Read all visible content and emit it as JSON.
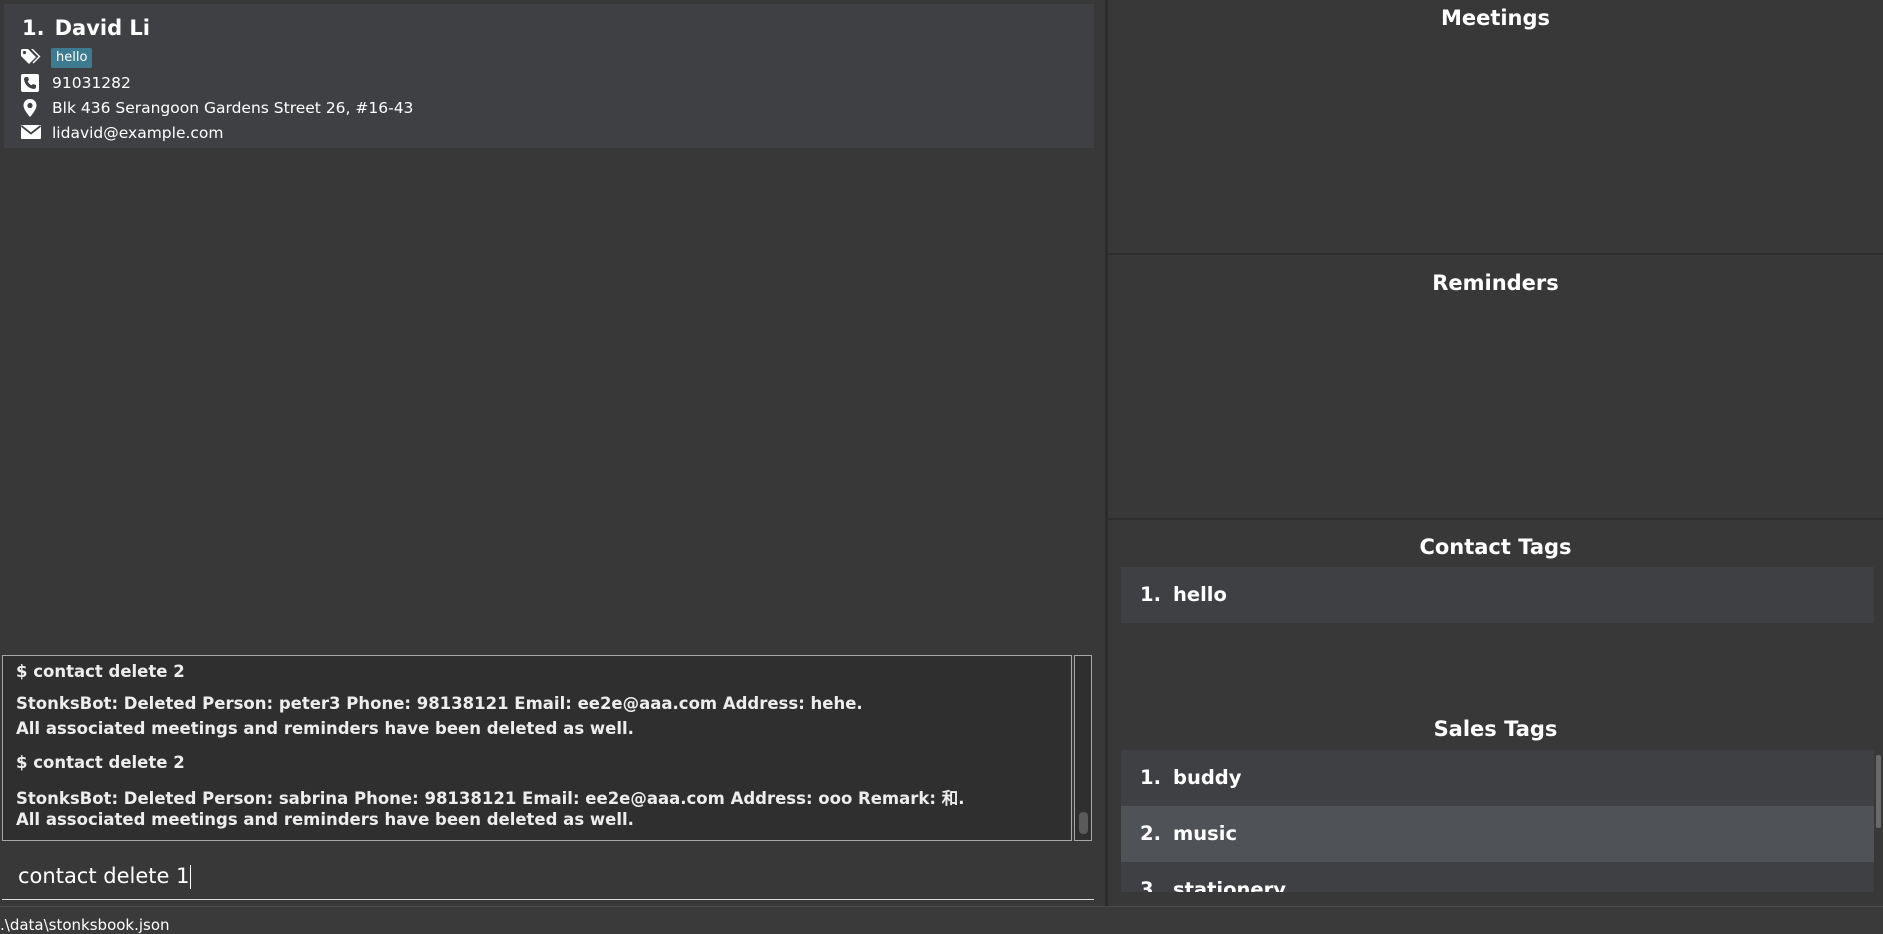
{
  "person_list": [
    {
      "index": "1.",
      "name": "David Li",
      "tags": [
        "hello"
      ],
      "phone": "91031282",
      "address": "Blk 436 Serangoon Gardens Street 26, #16-43",
      "email": "lidavid@example.com"
    }
  ],
  "result_display": {
    "lines": [
      "$ contact delete 2",
      "StonksBot: Deleted Person: peter3 Phone: 98138121 Email: ee2e@aaa.com Address: hehe.",
      "All associated meetings and reminders have been deleted as well.",
      "$ contact delete 2",
      "StonksBot: Deleted Person: sabrina Phone: 98138121 Email: ee2e@aaa.com Address: ooo Remark: 和.",
      "All associated meetings and reminders have been deleted as well."
    ]
  },
  "command_box": {
    "value": "contact delete 1"
  },
  "status_bar": {
    "file_path": ".\\data\\stonksbook.json"
  },
  "panels": {
    "meetings": {
      "title": "Meetings"
    },
    "reminders": {
      "title": "Reminders"
    },
    "contact_tags": {
      "title": "Contact Tags",
      "items": [
        {
          "index": "1.",
          "label": "hello"
        }
      ]
    },
    "sales_tags": {
      "title": "Sales Tags",
      "items": [
        {
          "index": "1.",
          "label": "buddy"
        },
        {
          "index": "2.",
          "label": "music"
        },
        {
          "index": "3.",
          "label": "stationery"
        }
      ],
      "selected_index": 1
    }
  },
  "icons": {
    "tag": "tags-icon",
    "phone": "phone-icon",
    "address": "map-pin-icon",
    "email": "envelope-icon"
  },
  "colors": {
    "background": "#383838",
    "card": "#3f4043",
    "tag_chip": "#3e7b91",
    "selected_item": "#4f5256",
    "result_background": "#2f2f2f"
  }
}
